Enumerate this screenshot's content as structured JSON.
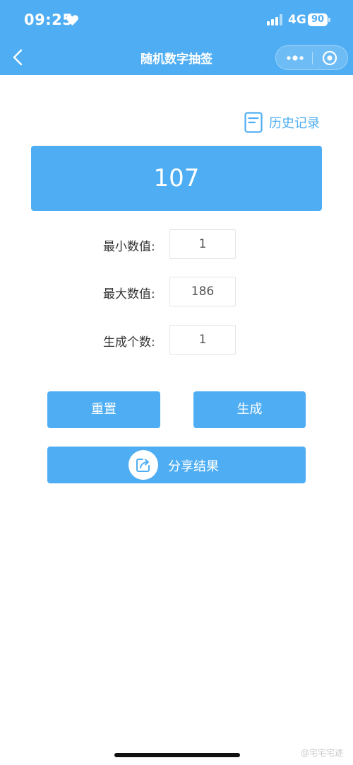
{
  "status": {
    "time": "09:25",
    "network": "4G",
    "battery": "90"
  },
  "nav": {
    "title": "随机数字抽签"
  },
  "history": {
    "label": "历史记录"
  },
  "result": {
    "value": "107"
  },
  "fields": [
    {
      "label": "最小数值:",
      "value": "1"
    },
    {
      "label": "最大数值:",
      "value": "186"
    },
    {
      "label": "生成个数:",
      "value": "1"
    }
  ],
  "buttons": {
    "reset": "重置",
    "generate": "生成",
    "share": "分享结果"
  },
  "watermark": "@宅宅宅迹",
  "colors": {
    "accent": "#4faef3",
    "background": "#ffffff"
  },
  "icons": [
    "heart-icon",
    "signal-icon",
    "battery-icon",
    "back-arrow-icon",
    "more-dots-icon",
    "target-icon",
    "document-icon",
    "share-icon"
  ]
}
